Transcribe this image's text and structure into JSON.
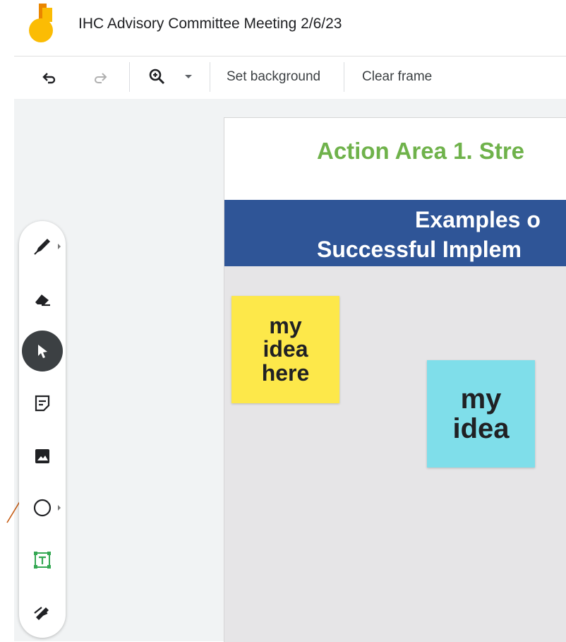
{
  "app": {
    "title": "IHC Advisory Committee Meeting 2/6/23",
    "logo_icon": "jamboard-logo"
  },
  "toolbar": {
    "undo_icon": "undo-icon",
    "redo_icon": "redo-icon",
    "zoom_icon": "zoom-in-icon",
    "zoom_dropdown_icon": "caret-down-icon",
    "set_background_label": "Set background",
    "clear_frame_label": "Clear frame"
  },
  "tools": [
    {
      "name": "pen",
      "icon": "pen-icon",
      "has_submenu": true,
      "active": false
    },
    {
      "name": "eraser",
      "icon": "eraser-icon",
      "has_submenu": false,
      "active": false
    },
    {
      "name": "select",
      "icon": "cursor-icon",
      "has_submenu": false,
      "active": true
    },
    {
      "name": "sticky-note",
      "icon": "sticky-note-icon",
      "has_submenu": false,
      "active": false
    },
    {
      "name": "image",
      "icon": "image-icon",
      "has_submenu": false,
      "active": false
    },
    {
      "name": "circle",
      "icon": "circle-icon",
      "has_submenu": true,
      "active": false
    },
    {
      "name": "text-box",
      "icon": "text-box-icon",
      "has_submenu": false,
      "active": false
    },
    {
      "name": "laser",
      "icon": "laser-icon",
      "has_submenu": false,
      "active": false
    }
  ],
  "frame": {
    "title": "Action Area 1. Stre",
    "banner_line1": "Examples o",
    "banner_line2": "Successful Implem",
    "notes": [
      {
        "text": "my idea here",
        "lines": [
          "my",
          "idea",
          "here"
        ],
        "color": "#fde84a"
      },
      {
        "text": "my idea",
        "lines": [
          "my",
          "idea"
        ],
        "color": "#7fdeea"
      }
    ]
  },
  "colors": {
    "title_green": "#6fb24b",
    "banner_blue": "#2f5597",
    "connector_orange": "#c55a11",
    "active_tool": "#3c4043",
    "text_box_green": "#34a853"
  }
}
